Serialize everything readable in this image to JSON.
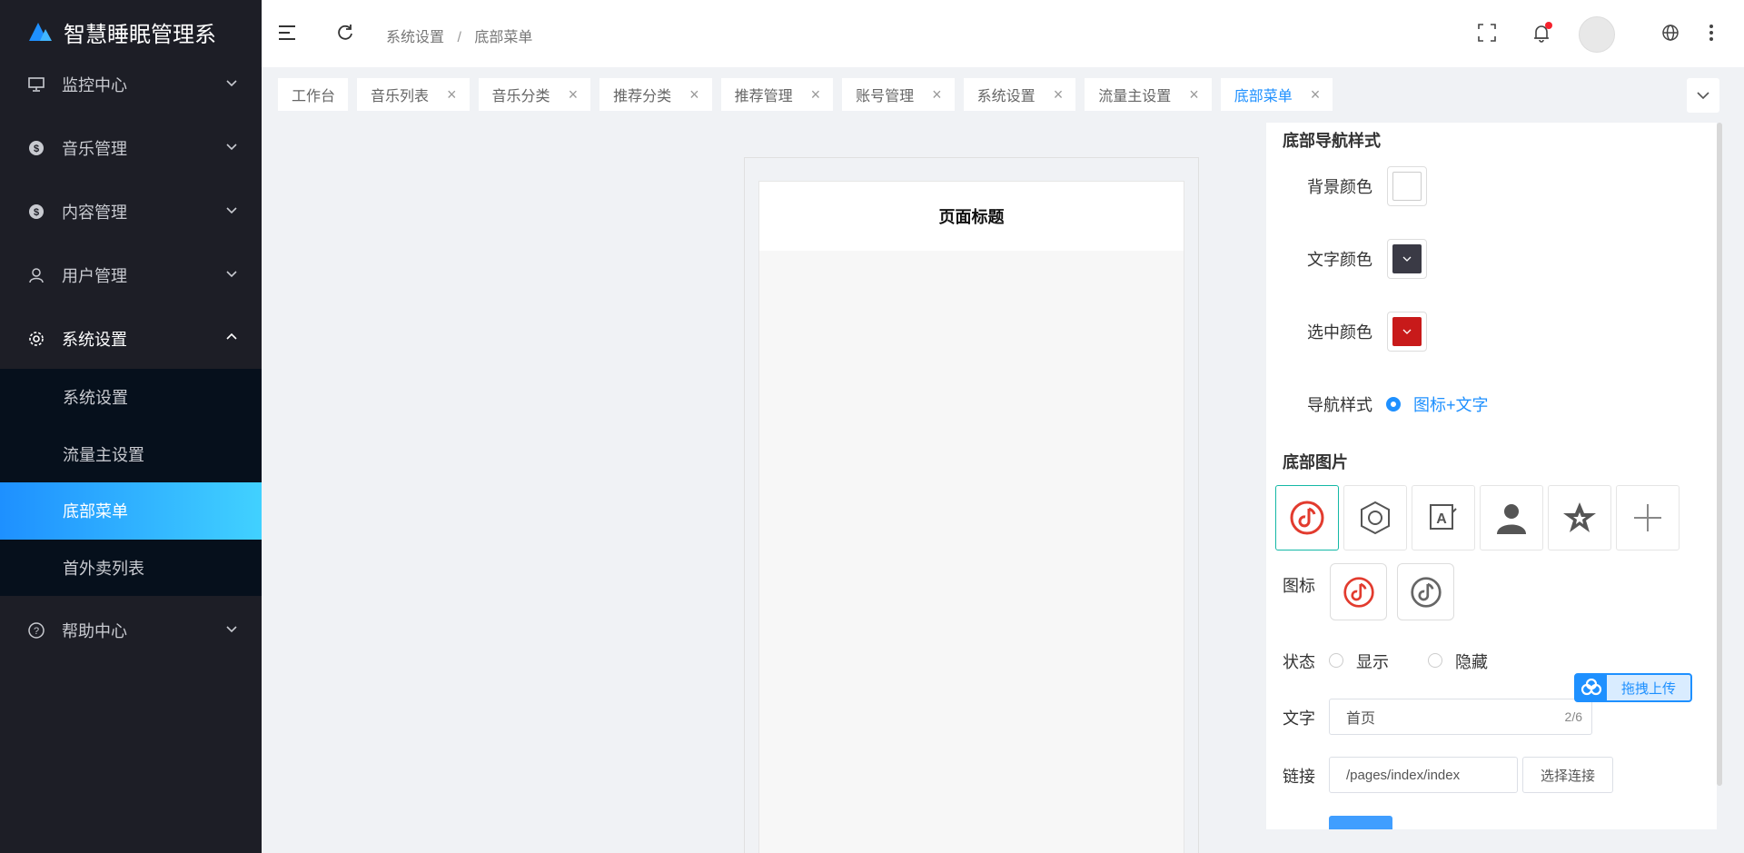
{
  "app": {
    "title": "智慧睡眠管理系"
  },
  "sidebar": {
    "items": [
      {
        "label": "监控中心",
        "icon": "monitor-icon"
      },
      {
        "label": "音乐管理",
        "icon": "dollar-icon"
      },
      {
        "label": "内容管理",
        "icon": "dollar-icon"
      },
      {
        "label": "用户管理",
        "icon": "user-icon"
      },
      {
        "label": "系统设置",
        "icon": "gear-icon"
      },
      {
        "label": "帮助中心",
        "icon": "help-icon"
      }
    ],
    "subitems": [
      {
        "label": "系统设置"
      },
      {
        "label": "流量主设置"
      },
      {
        "label": "底部菜单"
      },
      {
        "label": "首外卖列表"
      }
    ]
  },
  "header": {
    "breadcrumb": [
      "系统设置",
      "底部菜单"
    ],
    "breadcrumb_sep": "/"
  },
  "tabs": [
    {
      "label": "工作台",
      "closable": false
    },
    {
      "label": "音乐列表",
      "closable": true
    },
    {
      "label": "音乐分类",
      "closable": true
    },
    {
      "label": "推荐分类",
      "closable": true
    },
    {
      "label": "推荐管理",
      "closable": true
    },
    {
      "label": "账号管理",
      "closable": true
    },
    {
      "label": "系统设置",
      "closable": true
    },
    {
      "label": "流量主设置",
      "closable": true
    },
    {
      "label": "底部菜单",
      "closable": true,
      "active": true
    }
  ],
  "tab_close_glyph": "×",
  "phone": {
    "title": "页面标题"
  },
  "panel": {
    "nav_style_title": "底部导航样式",
    "bg_color_label": "背景颜色",
    "text_color_label": "文字颜色",
    "selected_color_label": "选中颜色",
    "nav_style_label": "导航样式",
    "nav_style_option": "图标+文字",
    "bottom_image_title": "底部图片",
    "icon_label": "图标",
    "status_label": "状态",
    "status_show": "显示",
    "status_hide": "隐藏",
    "text_label": "文字",
    "text_value": "首页",
    "text_count": "2/6",
    "link_label": "链接",
    "link_value": "/pages/index/index",
    "select_link_button": "选择连接"
  },
  "upload_badge": {
    "label": "拖拽上传"
  },
  "colors": {
    "sidebar_bg": "#1d1e26",
    "submenu_bg": "#06101c",
    "accent": "#1e90ff",
    "bg_color": "#ffffff",
    "text_color": "#3a3a45",
    "selected_color": "#c81a1a"
  }
}
